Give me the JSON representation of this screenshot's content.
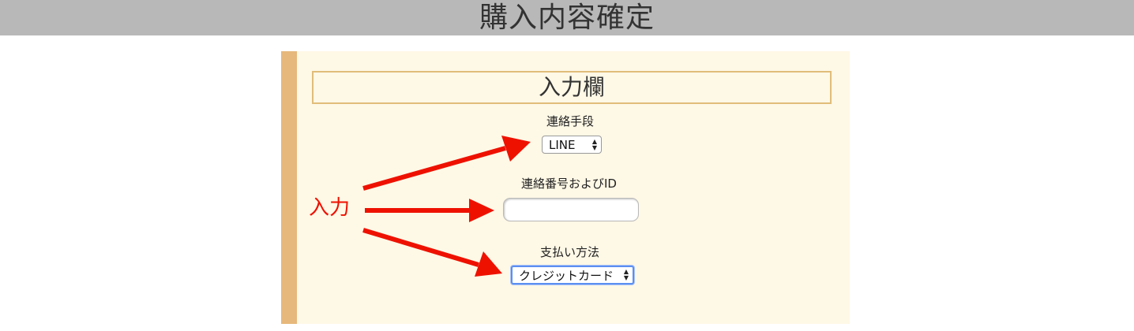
{
  "page": {
    "title": "購入内容確定"
  },
  "panel": {
    "section_title": "入力欄",
    "contact_method": {
      "label": "連絡手段",
      "selected": "LINE"
    },
    "contact_id": {
      "label": "連絡番号およびID",
      "value": ""
    },
    "payment_method": {
      "label": "支払い方法",
      "selected": "クレジットカード"
    }
  },
  "annotation": {
    "label": "入力",
    "color": "#ee1100"
  },
  "colors": {
    "title_bar": "#b8b8b8",
    "panel_bg": "#fef8e6",
    "panel_stripe": "#e6b87b",
    "focus_ring": "#5b8ef0"
  }
}
